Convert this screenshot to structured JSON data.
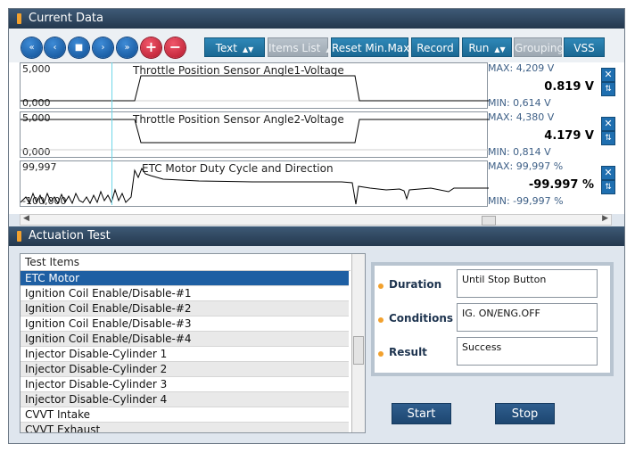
{
  "current_data": {
    "title": "Current Data",
    "toolbar": {
      "nav_buttons": [
        "«",
        "‹",
        "■",
        "›",
        "»"
      ],
      "add_label": "+",
      "remove_label": "−",
      "text_label": "Text",
      "items_list_label": "Items List",
      "reset_label": "Reset Min.Max",
      "record_label": "Record",
      "run_label": "Run",
      "grouping_label": "Grouping",
      "vss_label": "VSS"
    },
    "graphs": [
      {
        "title": "Throttle Position Sensor Angle1-Voltage",
        "scale_max": "5,000",
        "scale_min": "0,000",
        "max": "MAX: 4,209 V",
        "min": "MIN: 0,614 V",
        "value": "0.819 V",
        "color": "#000000"
      },
      {
        "title": "Throttle Position Sensor Angle2-Voltage",
        "scale_max": "5,000",
        "scale_min": "0,000",
        "max": "MAX: 4,380 V",
        "min": "MIN: 0,814 V",
        "value": "4.179 V",
        "color": "#000000"
      },
      {
        "title": "ETC Motor Duty Cycle and Direction",
        "scale_max": "99,997",
        "scale_min": "-100,000",
        "max": "MAX: 99,997 %",
        "min": "MIN: -99,997 %",
        "value": "-99.997 %",
        "color": "#000000"
      }
    ]
  },
  "actuation_test": {
    "title": "Actuation Test",
    "list_header": "Test Items",
    "items": [
      "ETC Motor",
      "Ignition Coil Enable/Disable-#1",
      "Ignition Coil Enable/Disable-#2",
      "Ignition Coil Enable/Disable-#3",
      "Ignition Coil Enable/Disable-#4",
      "Injector Disable-Cylinder 1",
      "Injector Disable-Cylinder 2",
      "Injector Disable-Cylinder 3",
      "Injector Disable-Cylinder 4",
      "CVVT Intake",
      "CVVT Exhaust"
    ],
    "selected_index": 0,
    "info": {
      "duration_label": "Duration",
      "duration_value": "Until Stop Button",
      "conditions_label": "Conditions",
      "conditions_value": "IG. ON/ENG.OFF",
      "result_label": "Result",
      "result_value": "Success"
    },
    "start_label": "Start",
    "stop_label": "Stop"
  },
  "colors": {
    "header": "#2d4560",
    "accent": "#1f6fb0",
    "selected_row": "#1e5fa3",
    "bullet": "#f2a12e"
  }
}
